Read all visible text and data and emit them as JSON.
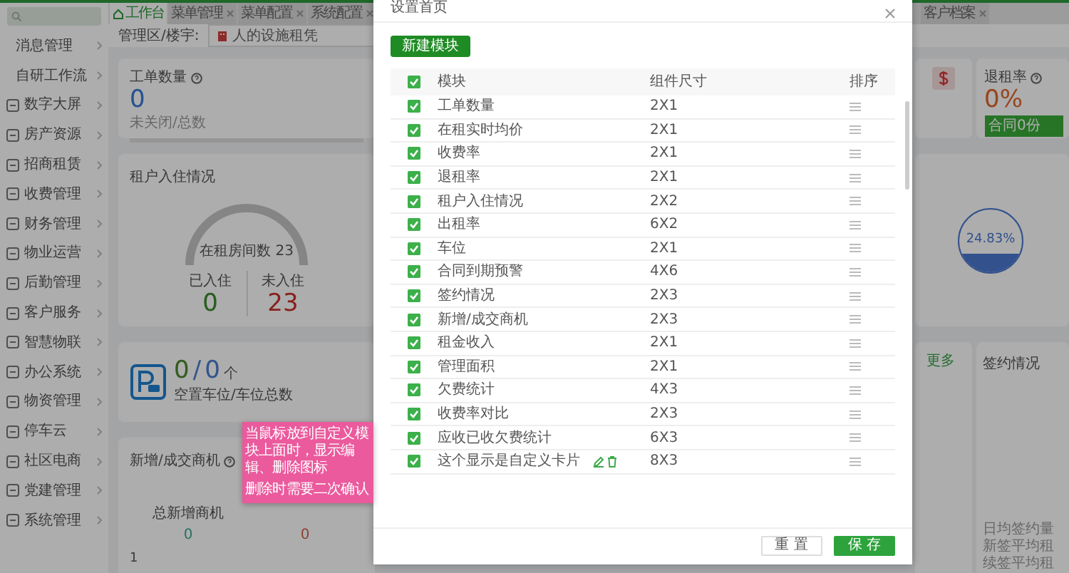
{
  "sidebar": {
    "items": [
      {
        "label": "消息管理",
        "kind": "sub"
      },
      {
        "label": "自研工作流",
        "kind": "sub"
      },
      {
        "label": "数字大屏",
        "kind": "main"
      },
      {
        "label": "房产资源",
        "kind": "main"
      },
      {
        "label": "招商租赁",
        "kind": "main"
      },
      {
        "label": "收费管理",
        "kind": "main"
      },
      {
        "label": "财务管理",
        "kind": "main"
      },
      {
        "label": "物业运营",
        "kind": "main"
      },
      {
        "label": "后勤管理",
        "kind": "main"
      },
      {
        "label": "客户服务",
        "kind": "main"
      },
      {
        "label": "智慧物联",
        "kind": "main"
      },
      {
        "label": "办公系统",
        "kind": "main"
      },
      {
        "label": "物资管理",
        "kind": "main"
      },
      {
        "label": "停车云",
        "kind": "main"
      },
      {
        "label": "社区电商",
        "kind": "main"
      },
      {
        "label": "党建管理",
        "kind": "main"
      },
      {
        "label": "系统管理",
        "kind": "main"
      }
    ]
  },
  "tabs": [
    {
      "label": "工作台",
      "selected": true,
      "closable": false
    },
    {
      "label": "菜单管理",
      "selected": false,
      "closable": true
    },
    {
      "label": "菜单配置",
      "selected": false,
      "closable": true
    },
    {
      "label": "系统配置",
      "selected": false,
      "closable": true
    },
    {
      "label": "客户档案",
      "selected": false,
      "closable": true
    }
  ],
  "filter": {
    "label": "管理区/楼宇:",
    "value": "人的设施租凭"
  },
  "work_orders": {
    "title": "工单数量",
    "value": "0",
    "caption": "未关闭/总数"
  },
  "occupancy": {
    "title": "租户入住情况",
    "gauge_label": "在租房间数 23",
    "stats": [
      {
        "label": "已入住",
        "value": "0"
      },
      {
        "label": "未入住",
        "value": "23"
      }
    ]
  },
  "parking": {
    "vacant": "0",
    "separator": "/",
    "total": "0",
    "unit": "个",
    "caption": "空置车位/车位总数"
  },
  "leads": {
    "title": "新增/成交商机",
    "metrics": [
      {
        "label": "总新增商机",
        "value": "0"
      },
      {
        "value": "0"
      }
    ],
    "axis_label": "1"
  },
  "vacancy": {
    "title": "退租率",
    "value": "0%",
    "badge": "合同0份"
  },
  "water_ball": {
    "reading": "24.83%"
  },
  "more_link": "更多",
  "signing": {
    "title": "签约情况",
    "lines": [
      "日均签约量",
      "新签平均租",
      "续签平均租"
    ]
  },
  "tooltip": {
    "paragraphs": [
      "当鼠标放到自定义模块上面时，显示编辑、删除图标",
      "删除时需要二次确认"
    ]
  },
  "modal": {
    "title": "设置首页",
    "new_button": "新建模块",
    "columns": [
      "模块",
      "组件尺寸",
      "排序"
    ],
    "all_checked": true,
    "rows": [
      {
        "name": "工单数量",
        "size": "2X1",
        "checked": true,
        "kind": "builtin"
      },
      {
        "name": "在租实时均价",
        "size": "2X1",
        "checked": true,
        "kind": "builtin"
      },
      {
        "name": "收费率",
        "size": "2X1",
        "checked": true,
        "kind": "builtin"
      },
      {
        "name": "退租率",
        "size": "2X1",
        "checked": true,
        "kind": "builtin"
      },
      {
        "name": "租户入住情况",
        "size": "2X2",
        "checked": true,
        "kind": "builtin"
      },
      {
        "name": "出租率",
        "size": "6X2",
        "checked": true,
        "kind": "builtin"
      },
      {
        "name": "车位",
        "size": "2X1",
        "checked": true,
        "kind": "builtin"
      },
      {
        "name": "合同到期预警",
        "size": "4X6",
        "checked": true,
        "kind": "builtin"
      },
      {
        "name": "签约情况",
        "size": "2X3",
        "checked": true,
        "kind": "builtin"
      },
      {
        "name": "新增/成交商机",
        "size": "2X3",
        "checked": true,
        "kind": "builtin"
      },
      {
        "name": "租金收入",
        "size": "2X1",
        "checked": true,
        "kind": "builtin"
      },
      {
        "name": "管理面积",
        "size": "2X1",
        "checked": true,
        "kind": "builtin"
      },
      {
        "name": "欠费统计",
        "size": "4X3",
        "checked": true,
        "kind": "builtin"
      },
      {
        "name": "收费率对比",
        "size": "2X3",
        "checked": true,
        "kind": "builtin"
      },
      {
        "name": "应收已收欠费统计",
        "size": "6X3",
        "checked": true,
        "kind": "builtin"
      },
      {
        "name": "这个显示是自定义卡片",
        "size": "8X3",
        "checked": true,
        "kind": "custom"
      }
    ],
    "buttons": [
      {
        "label": "重 置",
        "kind": "default"
      },
      {
        "label": "保 存",
        "kind": "primary"
      }
    ]
  }
}
